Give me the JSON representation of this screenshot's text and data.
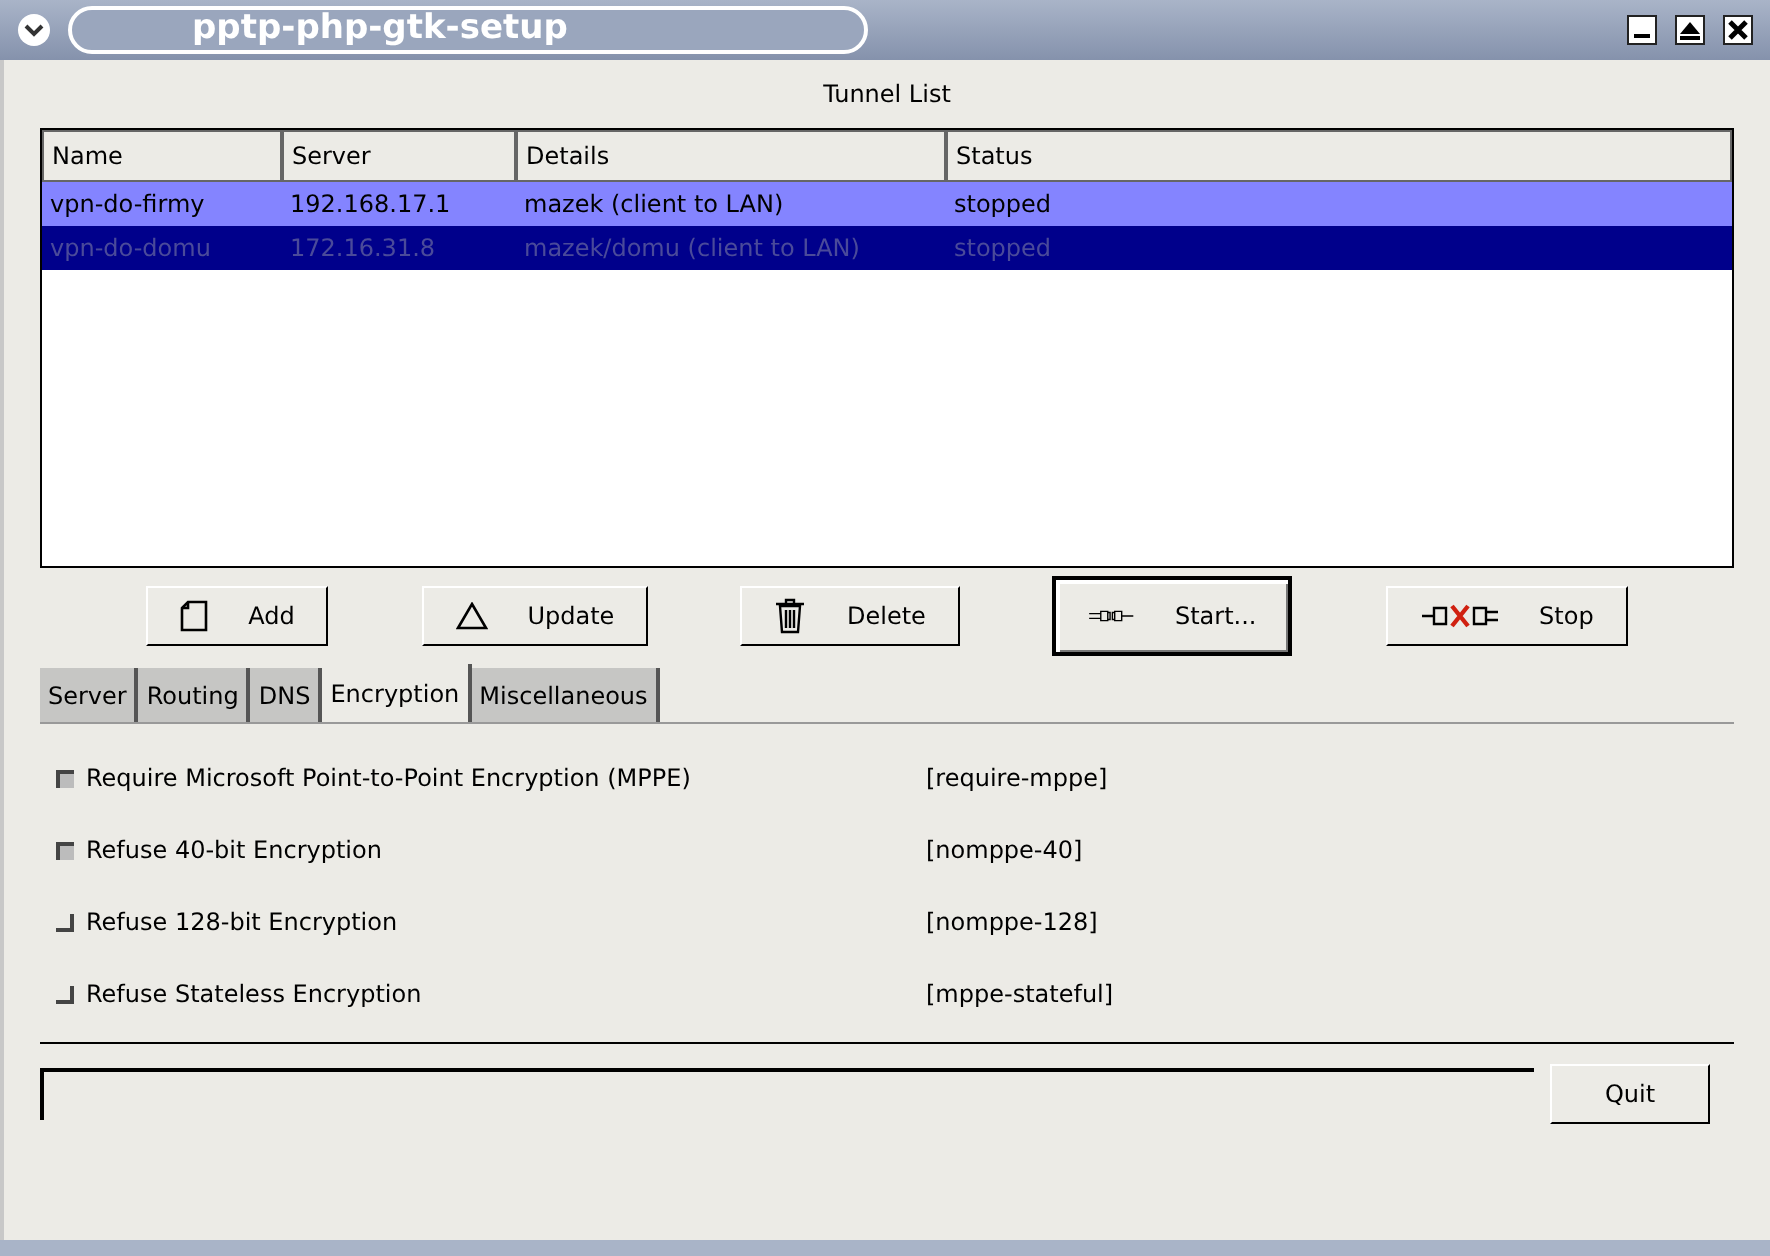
{
  "window": {
    "title": "pptp-php-gtk-setup"
  },
  "tunnel_list": {
    "title": "Tunnel List",
    "columns": [
      "Name",
      "Server",
      "Details",
      "Status"
    ],
    "rows": [
      {
        "cells": [
          "vpn-do-firmy",
          "192.168.17.1",
          "mazek (client to LAN)",
          "stopped"
        ],
        "selected": false,
        "prelight": true
      },
      {
        "cells": [
          "vpn-do-domu",
          "172.16.31.8",
          "mazek/domu (client to LAN)",
          "stopped"
        ],
        "selected": true,
        "prelight": false
      }
    ]
  },
  "buttons": [
    {
      "label": "Add",
      "kind": "add",
      "focused": false
    },
    {
      "label": "Update",
      "kind": "update",
      "focused": false
    },
    {
      "label": "Delete",
      "kind": "delete",
      "focused": false
    },
    {
      "label": "Start...",
      "kind": "start",
      "focused": true
    },
    {
      "label": "Stop",
      "kind": "stop",
      "focused": false
    }
  ],
  "tabs": [
    {
      "label": "Server",
      "selected": false
    },
    {
      "label": "Routing",
      "selected": false
    },
    {
      "label": "DNS",
      "selected": false
    },
    {
      "label": "Encryption",
      "selected": true
    },
    {
      "label": "Miscellaneous",
      "selected": false
    }
  ],
  "options": [
    {
      "label": "Require Microsoft Point-to-Point Encryption (MPPE)",
      "option": "[require-mppe]",
      "checked": true
    },
    {
      "label": "Refuse 40-bit Encryption",
      "option": "[nomppe-40]",
      "checked": true
    },
    {
      "label": "Refuse 128-bit Encryption",
      "option": "[nomppe-128]",
      "checked": false
    },
    {
      "label": "Refuse Stateless Encryption",
      "option": "[mppe-stateful]",
      "checked": false
    }
  ],
  "quit_button": {
    "label": "Quit"
  }
}
